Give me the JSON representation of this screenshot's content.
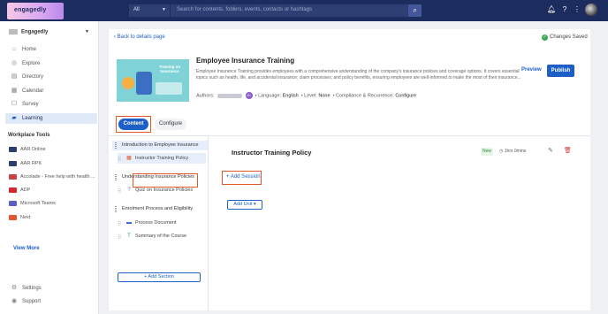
{
  "topbar": {
    "logo_text": "engagedly",
    "filter": "All",
    "search_placeholder": "Search for contents, folders, events, contacts or hashtags"
  },
  "sidebar": {
    "org_name": "Engagedly",
    "items": [
      {
        "label": "Home",
        "icon": "home-icon"
      },
      {
        "label": "Explore",
        "icon": "compass-icon"
      },
      {
        "label": "Directory",
        "icon": "directory-icon"
      },
      {
        "label": "Calendar",
        "icon": "calendar-icon"
      },
      {
        "label": "Survey",
        "icon": "survey-icon"
      },
      {
        "label": "Learning",
        "icon": "learning-icon",
        "active": true
      }
    ],
    "tools_title": "Workplace Tools",
    "tools": [
      {
        "label": "AAR Online",
        "color": "#2a3d6e"
      },
      {
        "label": "AAR RPK",
        "color": "#2a3d6e"
      },
      {
        "label": "Accolade - Free help with health ...",
        "color": "#c94545"
      },
      {
        "label": "ADP",
        "color": "#d8262e"
      },
      {
        "label": "Microsoft Teams",
        "color": "#5b5fc7"
      },
      {
        "label": "Next",
        "color": "#e8542e"
      }
    ],
    "view_more": "View More",
    "bottom": [
      {
        "label": "Settings",
        "icon": "gear-icon"
      },
      {
        "label": "Support",
        "icon": "support-icon"
      }
    ]
  },
  "header": {
    "back_link": "Back to details page",
    "status": "Changes Saved"
  },
  "course": {
    "thumbnail_text": "Training on Insurance",
    "title": "Employee Insurance Training",
    "description": "Employee Insurance Training provides employees with a comprehensive understanding of the company's insurance policies and coverage options. It covers essential topics such as health, life, and accidental insurance; claim processes; and policy benefits, ensuring employees are well-informed to make the most of their insurance...",
    "authors_label": "Authors:",
    "author_badge": "JK",
    "language_label": "Language:",
    "language": "English",
    "level_label": "Level:",
    "level": "None",
    "compliance_label": "Compliance & Recurrence:",
    "compliance": "Configure",
    "preview": "Preview",
    "publish": "Publish"
  },
  "tabs": {
    "content": "Content",
    "configure": "Configure"
  },
  "sections": [
    {
      "title": "Introduction to Employee Insurance"
    },
    {
      "title": "Understanding Insurance Policies"
    },
    {
      "title": "Enrolment Process and Eligibility"
    }
  ],
  "lessons": [
    {
      "title": "Instructor Training Policy",
      "icon": "book-icon",
      "color": "#e0572a"
    },
    {
      "title": "Quiz on Insurance Policies",
      "icon": "quiz-icon",
      "color": "#8a5cc7"
    },
    {
      "title": "Process Document",
      "icon": "document-icon",
      "color": "#1d5fc7"
    },
    {
      "title": "Summary of the Course",
      "icon": "summary-icon",
      "color": "#3aa757"
    }
  ],
  "add_section": "Add Section",
  "detail": {
    "title": "Instructor Training Policy",
    "badge": "New",
    "duration": "1hrs 0mins",
    "add_session": "Add Session",
    "add_unit": "Add Unit"
  }
}
